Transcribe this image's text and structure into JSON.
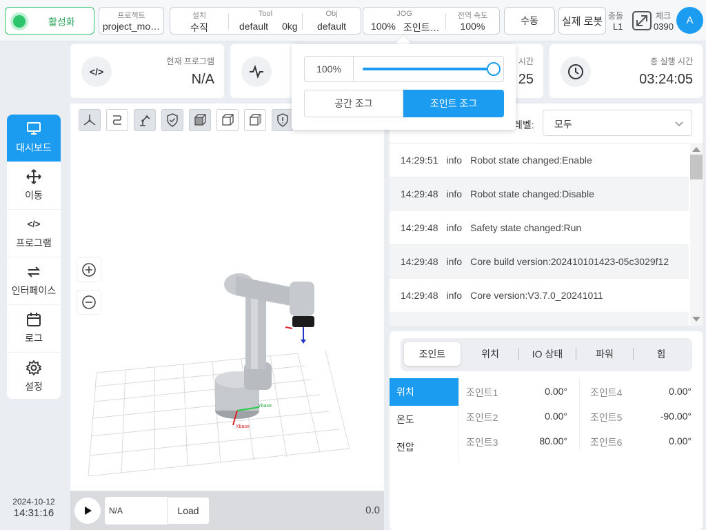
{
  "topbar": {
    "status_label": "활성화",
    "project": {
      "label": "프로젝트",
      "value": "project_mo…"
    },
    "install": {
      "label": "설치",
      "value": "수직"
    },
    "tool": {
      "label": "Tool",
      "value": "default",
      "weight": "0kg"
    },
    "obj": {
      "label": "Obj",
      "value": "default"
    },
    "jog": {
      "label": "JOG",
      "percent": "100%",
      "mode": "조인트…"
    },
    "speed": {
      "label": "전역 속도",
      "value": "100%"
    },
    "manual_label": "수동",
    "real_robot_label": "실제 로봇",
    "collision": {
      "label": "충돌",
      "value": "L1"
    },
    "check": {
      "label": "체크",
      "value": "0390"
    },
    "avatar_letter": "A"
  },
  "cards": {
    "program": {
      "label": "현재 프로그램",
      "value": "N/A",
      "icon": "code-icon"
    },
    "cycle": {
      "label": "시간",
      "value": "25",
      "icon": "pulse-icon"
    },
    "total": {
      "label": "총 실행 시간",
      "value": "03:24:05",
      "icon": "clock-icon"
    }
  },
  "sidebar": {
    "items": [
      {
        "label": "대시보드",
        "icon": "monitor-icon",
        "glyph": "🖥"
      },
      {
        "label": "이동",
        "icon": "move-icon",
        "glyph": "✥"
      },
      {
        "label": "프로그램",
        "icon": "code-icon",
        "glyph": "</>"
      },
      {
        "label": "인터페이스",
        "icon": "swap-icon",
        "glyph": "⇄"
      },
      {
        "label": "로그",
        "icon": "calendar-icon",
        "glyph": "▦"
      },
      {
        "label": "설정",
        "icon": "gear-icon",
        "glyph": "⚙"
      }
    ]
  },
  "datetime": {
    "date": "2024-10-12",
    "time": "14:31:16"
  },
  "viewport": {
    "toolbar_icons": [
      "axes-icon",
      "path-icon",
      "robot-arm-icon",
      "shield-check-icon",
      "cube-front-icon",
      "cube-iso-icon",
      "cube-side-icon",
      "shield-alert-icon"
    ],
    "zoom_in": "+",
    "zoom_out": "−",
    "program_value": "N/A",
    "load_label": "Load",
    "progress_value": "0.0",
    "axis_labels": {
      "x": "Xbase",
      "y": "Ybase"
    }
  },
  "jog_popup": {
    "percent": "100%",
    "slider_value": 1.0,
    "space_jog": "공간 조그",
    "joint_jog": "조인트 조그"
  },
  "log": {
    "level_label": "레벨:",
    "level_value": "모두",
    "entries": [
      {
        "time": "14:29:51",
        "level": "info",
        "msg": "Robot state changed:Enable"
      },
      {
        "time": "14:29:48",
        "level": "info",
        "msg": "Robot state changed:Disable"
      },
      {
        "time": "14:29:48",
        "level": "info",
        "msg": "Safety state changed:Run"
      },
      {
        "time": "14:29:48",
        "level": "info",
        "msg": "Core build version:202410101423-05c3029f12"
      },
      {
        "time": "14:29:48",
        "level": "info",
        "msg": "Core version:V3.7.0_20241011"
      }
    ]
  },
  "joint_panel": {
    "tabs": [
      "조인트",
      "위치",
      "IO 상태",
      "파워",
      "힘"
    ],
    "subtabs": [
      "위치",
      "온도",
      "전압"
    ],
    "joints": [
      {
        "name": "조인트1",
        "value": "0.00°"
      },
      {
        "name": "조인트2",
        "value": "0.00°"
      },
      {
        "name": "조인트3",
        "value": "80.00°"
      },
      {
        "name": "조인트4",
        "value": "0.00°"
      },
      {
        "name": "조인트5",
        "value": "-90.00°"
      },
      {
        "name": "조인트6",
        "value": "0.00°"
      }
    ]
  },
  "colors": {
    "accent": "#1b9cf0",
    "status_green": "#2ec46b"
  }
}
